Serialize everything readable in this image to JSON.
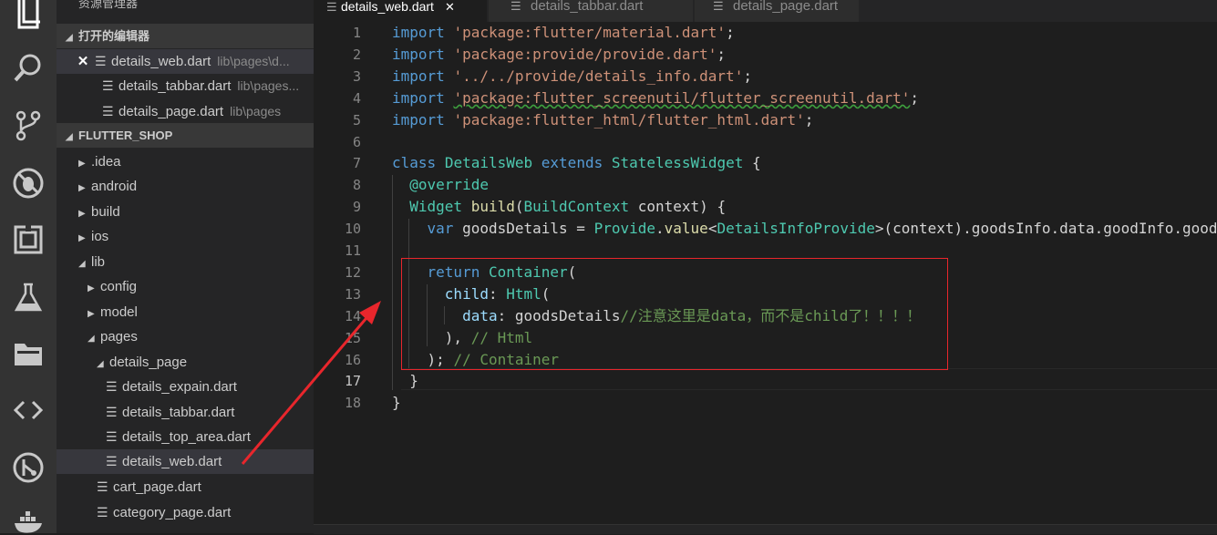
{
  "activity_bar": {
    "icons": [
      "files-icon",
      "search-icon",
      "source-control-icon",
      "debug-icon",
      "extensions-icon",
      "test-flask-icon",
      "folder-icon",
      "code-brackets-icon",
      "git-graph-icon",
      "docker-icon"
    ]
  },
  "sidebar": {
    "title": "资源管理器",
    "open_editors_header": "打开的编辑器",
    "open_editors": [
      {
        "name": "details_web.dart",
        "path": "lib\\pages\\d...",
        "close": "✕"
      },
      {
        "name": "details_tabbar.dart",
        "path": "lib\\pages..."
      },
      {
        "name": "details_page.dart",
        "path": "lib\\pages"
      }
    ],
    "project_header": "FLUTTER_SHOP",
    "tree": [
      {
        "name": ".idea",
        "arrow": "▶"
      },
      {
        "name": "android",
        "arrow": "▶"
      },
      {
        "name": "build",
        "arrow": "▶"
      },
      {
        "name": "ios",
        "arrow": "▶"
      },
      {
        "name": "lib",
        "arrow": "◢"
      },
      {
        "name": "config",
        "arrow": "▶"
      },
      {
        "name": "model",
        "arrow": "▶"
      },
      {
        "name": "pages",
        "arrow": "◢"
      },
      {
        "name": "details_page",
        "arrow": "◢"
      },
      {
        "name": "details_expain.dart"
      },
      {
        "name": "details_tabbar.dart"
      },
      {
        "name": "details_top_area.dart"
      },
      {
        "name": "details_web.dart"
      },
      {
        "name": "cart_page.dart"
      },
      {
        "name": "category_page.dart"
      }
    ]
  },
  "tabs": [
    {
      "label": "details_web.dart",
      "close": "✕"
    },
    {
      "label": "details_tabbar.dart"
    },
    {
      "label": "details_page.dart"
    }
  ],
  "editor": {
    "line_numbers": [
      "1",
      "2",
      "3",
      "4",
      "5",
      "6",
      "7",
      "8",
      "9",
      "10",
      "11",
      "12",
      "13",
      "14",
      "15",
      "16",
      "17",
      "18"
    ],
    "lines": [
      [
        [
          "kw",
          "import"
        ],
        [
          "plain",
          " "
        ],
        [
          "str",
          "'package:flutter/material.dart'"
        ],
        [
          "plain",
          ";"
        ]
      ],
      [
        [
          "kw",
          "import"
        ],
        [
          "plain",
          " "
        ],
        [
          "str",
          "'package:provide/provide.dart'"
        ],
        [
          "plain",
          ";"
        ]
      ],
      [
        [
          "kw",
          "import"
        ],
        [
          "plain",
          " "
        ],
        [
          "str",
          "'../../provide/details_info.dart'"
        ],
        [
          "plain",
          ";"
        ]
      ],
      [
        [
          "kw",
          "import"
        ],
        [
          "plain",
          " "
        ],
        [
          "strsq",
          "'package:flutter_screenutil/flutter_screenutil.dart'"
        ],
        [
          "plain",
          ";"
        ]
      ],
      [
        [
          "kw",
          "import"
        ],
        [
          "plain",
          " "
        ],
        [
          "str",
          "'package:flutter_html/flutter_html.dart'"
        ],
        [
          "plain",
          ";"
        ]
      ],
      [],
      [
        [
          "kw",
          "class"
        ],
        [
          "plain",
          " "
        ],
        [
          "cls",
          "DetailsWeb"
        ],
        [
          "plain",
          " "
        ],
        [
          "kw",
          "extends"
        ],
        [
          "plain",
          " "
        ],
        [
          "cls",
          "StatelessWidget"
        ],
        [
          "plain",
          " {"
        ]
      ],
      [
        [
          "plain",
          "  "
        ],
        [
          "cls",
          "@override"
        ]
      ],
      [
        [
          "plain",
          "  "
        ],
        [
          "cls",
          "Widget"
        ],
        [
          "plain",
          " "
        ],
        [
          "fn",
          "build"
        ],
        [
          "plain",
          "("
        ],
        [
          "cls",
          "BuildContext"
        ],
        [
          "plain",
          " context) {"
        ]
      ],
      [
        [
          "plain",
          "    "
        ],
        [
          "kw",
          "var"
        ],
        [
          "plain",
          " goodsDetails = "
        ],
        [
          "cls",
          "Provide"
        ],
        [
          "plain",
          "."
        ],
        [
          "fn",
          "value"
        ],
        [
          "plain",
          "<"
        ],
        [
          "cls",
          "DetailsInfoProvide"
        ],
        [
          "plain",
          ">(context).goodsInfo.data.goodInfo.good"
        ]
      ],
      [],
      [
        [
          "plain",
          "    "
        ],
        [
          "kw",
          "return"
        ],
        [
          "plain",
          " "
        ],
        [
          "cls",
          "Container"
        ],
        [
          "plain",
          "("
        ]
      ],
      [
        [
          "plain",
          "      "
        ],
        [
          "var",
          "child"
        ],
        [
          "plain",
          ": "
        ],
        [
          "cls",
          "Html"
        ],
        [
          "plain",
          "("
        ]
      ],
      [
        [
          "plain",
          "        "
        ],
        [
          "var",
          "data"
        ],
        [
          "plain",
          ": goodsDetails"
        ],
        [
          "cm",
          "//注意这里是data，而不是child了！！！！"
        ]
      ],
      [
        [
          "plain",
          "      ), "
        ],
        [
          "cm",
          "// Html"
        ]
      ],
      [
        [
          "plain",
          "    ); "
        ],
        [
          "cm",
          "// Container"
        ]
      ],
      [
        [
          "plain",
          "  }"
        ]
      ],
      [
        [
          "plain",
          "}"
        ]
      ]
    ]
  }
}
